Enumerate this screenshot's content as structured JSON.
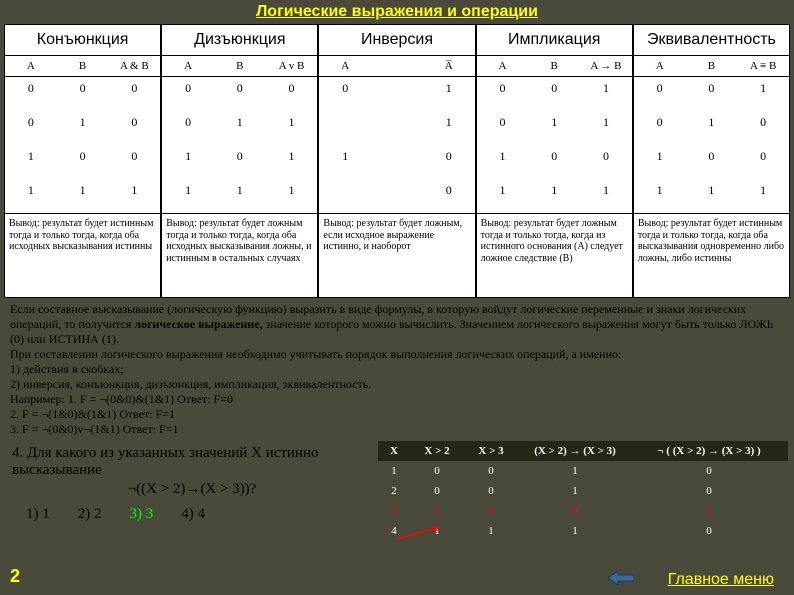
{
  "title": "Логические выражения и операции",
  "ops": [
    {
      "name": "Конъюнкция",
      "cols": [
        "A",
        "B",
        "A & B"
      ],
      "rows": [
        [
          "0",
          "0",
          "0"
        ],
        [
          "0",
          "1",
          "0"
        ],
        [
          "1",
          "0",
          "0"
        ],
        [
          "1",
          "1",
          "1"
        ]
      ],
      "note": "Вывод: результат будет истинным тогда и только тогда, когда оба исходных высказывания истинны"
    },
    {
      "name": "Дизъюнкция",
      "cols": [
        "A",
        "B",
        "A v B"
      ],
      "rows": [
        [
          "0",
          "0",
          "0"
        ],
        [
          "0",
          "1",
          "1"
        ],
        [
          "1",
          "0",
          "1"
        ],
        [
          "1",
          "1",
          "1"
        ]
      ],
      "note": "Вывод: результат будет ложным тогда и только тогда, когда оба исходных высказывания ложны, и истинным в остальных случаях"
    },
    {
      "name": "Инверсия",
      "cols": [
        "A",
        "",
        "A̅"
      ],
      "rows": [
        [
          "0",
          "",
          "1"
        ],
        [
          "",
          "",
          "1"
        ],
        [
          "1",
          "",
          "0"
        ],
        [
          "",
          "",
          "0"
        ]
      ],
      "note": "Вывод: результат будет ложным, если исходное выражение истинно, и наоборот"
    },
    {
      "name": "Импликация",
      "cols": [
        "A",
        "B",
        "A → B"
      ],
      "rows": [
        [
          "0",
          "0",
          "1"
        ],
        [
          "0",
          "1",
          "1"
        ],
        [
          "1",
          "0",
          "0"
        ],
        [
          "1",
          "1",
          "1"
        ]
      ],
      "note": "Вывод: результат будет ложным тогда и только тогда, когда из истинного основания (A) следует ложное следствие (B)"
    },
    {
      "name": "Эквивалентность",
      "cols": [
        "A",
        "B",
        "A ≡ B"
      ],
      "rows": [
        [
          "0",
          "0",
          "1"
        ],
        [
          "0",
          "1",
          "0"
        ],
        [
          "1",
          "0",
          "0"
        ],
        [
          "1",
          "1",
          "1"
        ]
      ],
      "note": "Вывод: результат будет истинным тогда и только тогда, когда оба высказывания одновременно либо ложны, либо истинны"
    }
  ],
  "explain_p1a": "   Если составное высказывание (логическую функцию) выразить в виде формулы, в которую войдут логические переменные и знаки логических операций, то получится ",
  "explain_bold": "логическое выражение,",
  "explain_p1b": " значение которого можно вычислить. Значением логического выражения могут быть только ЛОЖЬ (0) или ИСТИНА (1).",
  "explain_p2": "    При составлении логического выражения необходимо учитывать порядок выполнения логических операций, а именно:",
  "explain_l1": "1)  действия в скобках;",
  "explain_l2": "2)  инверсия, конъюнкция, дизъюнкция, импликация, эквивалентность.",
  "explain_ex": "Например: 1. F = ¬(0&0)&(1&1)  Ответ: F=0",
  "explain_ex2": "2. F =  ¬(1&0)&(1&1)  Ответ: F=1",
  "explain_ex3": "3. F =  ¬(0&0)v¬(1&1)  Ответ: F=1",
  "question_l1": "4. Для какого из указанных значений X истинно высказывание",
  "question_l2": "¬((X > 2)→(X > 3))?",
  "answers": {
    "a1": "1) 1",
    "a2": "2) 2",
    "a3": "3) 3",
    "a4": "4) 4"
  },
  "eval": {
    "headers": [
      "X",
      "X > 2",
      "X > 3",
      "(X > 2) → (X > 3)",
      "¬ ( (X > 2) → (X > 3) )"
    ],
    "rows": [
      {
        "v": [
          "1",
          "0",
          "0",
          "1",
          "0"
        ],
        "hl": false
      },
      {
        "v": [
          "2",
          "0",
          "0",
          "1",
          "0"
        ],
        "hl": false
      },
      {
        "v": [
          "3",
          "1",
          "0",
          "0",
          "1"
        ],
        "hl": true
      },
      {
        "v": [
          "4",
          "1",
          "1",
          "1",
          "0"
        ],
        "hl": false
      }
    ]
  },
  "page": "2",
  "menu": "Главное меню"
}
